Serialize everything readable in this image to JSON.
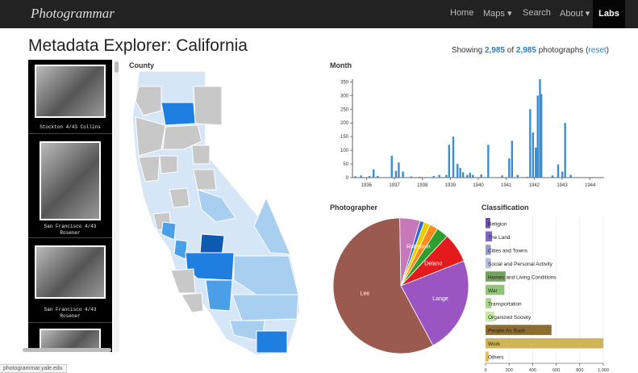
{
  "nav": {
    "brand": "Photogrammar",
    "items": [
      "Home",
      "Maps",
      "Search",
      "About"
    ],
    "labs": "Labs"
  },
  "page": {
    "title": "Metadata Explorer: California",
    "showing_prefix": "Showing",
    "showing_count": "2,985",
    "showing_of": "of",
    "showing_total": "2,985",
    "showing_suffix": "photographs (",
    "reset": "reset",
    "reset_close": ")"
  },
  "photos": [
    {
      "caption_1": "Stockton 4/43 Collins",
      "caption_2": ""
    },
    {
      "caption_1": "San Francisco 4/43",
      "caption_2": "Rosener"
    },
    {
      "caption_1": "San Francisco 4/43",
      "caption_2": "Rosener"
    },
    {
      "caption_1": "",
      "caption_2": ""
    }
  ],
  "sections": {
    "county": "County",
    "month": "Month",
    "photographer": "Photographer",
    "classification": "Classification"
  },
  "status_bar": "photogrammar.yale.edu",
  "colors": {
    "map_light": "#d6e6f7",
    "map_mid": "#a8cff0",
    "map_blue": "#4a9fe6",
    "map_bright": "#1f7fe0",
    "map_dark": "#0d5ab0",
    "map_gray": "#c8c8c8",
    "bar_blue": "#3a8ed0"
  },
  "chart_data": [
    {
      "type": "bar",
      "title": "Month",
      "x_ticks": [
        "1936",
        "1937",
        "1938",
        "1939",
        "1940",
        "1941",
        "1942",
        "1943",
        "1944"
      ],
      "y_ticks": [
        0,
        50,
        100,
        150,
        200,
        250,
        300,
        350
      ],
      "ylim": [
        0,
        360
      ],
      "x_range": [
        1935.5,
        1944.5
      ],
      "bars": [
        {
          "x": 1935.6,
          "y": 5
        },
        {
          "x": 1935.8,
          "y": 8
        },
        {
          "x": 1936.1,
          "y": 6
        },
        {
          "x": 1936.25,
          "y": 30
        },
        {
          "x": 1936.4,
          "y": 6
        },
        {
          "x": 1936.9,
          "y": 80
        },
        {
          "x": 1937.05,
          "y": 25
        },
        {
          "x": 1937.15,
          "y": 55
        },
        {
          "x": 1937.3,
          "y": 22
        },
        {
          "x": 1937.6,
          "y": 4
        },
        {
          "x": 1937.9,
          "y": 3
        },
        {
          "x": 1938.4,
          "y": 6
        },
        {
          "x": 1938.6,
          "y": 10
        },
        {
          "x": 1938.85,
          "y": 10
        },
        {
          "x": 1938.95,
          "y": 120
        },
        {
          "x": 1939.1,
          "y": 150
        },
        {
          "x": 1939.25,
          "y": 50
        },
        {
          "x": 1939.35,
          "y": 35
        },
        {
          "x": 1939.45,
          "y": 20
        },
        {
          "x": 1939.6,
          "y": 10
        },
        {
          "x": 1939.7,
          "y": 18
        },
        {
          "x": 1939.8,
          "y": 10
        },
        {
          "x": 1940.1,
          "y": 12
        },
        {
          "x": 1940.35,
          "y": 120
        },
        {
          "x": 1940.85,
          "y": 8
        },
        {
          "x": 1941.1,
          "y": 70
        },
        {
          "x": 1941.2,
          "y": 135
        },
        {
          "x": 1941.4,
          "y": 10
        },
        {
          "x": 1941.75,
          "y": 3
        },
        {
          "x": 1941.85,
          "y": 250
        },
        {
          "x": 1941.95,
          "y": 165
        },
        {
          "x": 1942.05,
          "y": 110
        },
        {
          "x": 1942.12,
          "y": 300
        },
        {
          "x": 1942.2,
          "y": 360
        },
        {
          "x": 1942.25,
          "y": 305
        },
        {
          "x": 1942.65,
          "y": 8
        },
        {
          "x": 1942.85,
          "y": 48
        },
        {
          "x": 1943.0,
          "y": 22
        },
        {
          "x": 1943.1,
          "y": 200
        },
        {
          "x": 1943.3,
          "y": 10
        }
      ]
    },
    {
      "type": "pie",
      "title": "Photographer",
      "slices": [
        {
          "name": "Lee",
          "value": 1720,
          "color": "#9b5a4f"
        },
        {
          "name": "Lange",
          "value": 690,
          "color": "#9b55c2"
        },
        {
          "name": "Delano",
          "value": 210,
          "color": "#e41a1c"
        },
        {
          "name": "",
          "value": 85,
          "color": "#2ca02c"
        },
        {
          "name": "Rothstein",
          "value": 60,
          "color": "#ff8c1a"
        },
        {
          "name": "",
          "value": 45,
          "color": "#e8d000"
        },
        {
          "name": "",
          "value": 30,
          "color": "#2b6bd8"
        },
        {
          "name": "",
          "value": 145,
          "color": "#c678b8"
        }
      ]
    },
    {
      "type": "bar",
      "title": "Classification",
      "orientation": "horizontal",
      "x_ticks": [
        "0",
        "200",
        "400",
        "600",
        "800",
        "1,000"
      ],
      "xlim": [
        0,
        1000
      ],
      "categories": [
        "Religion",
        "The Land",
        "Cities and Towns",
        "Social and Personal Activity",
        "Homes and Living Conditions",
        "War",
        "Transportation",
        "Organized Society",
        "People As Such",
        "Work",
        "Others"
      ],
      "values": [
        40,
        55,
        45,
        45,
        170,
        160,
        50,
        75,
        560,
        1000,
        25
      ],
      "colors": [
        "#6a51a3",
        "#7b68c9",
        "#9e9ac8",
        "#bcbddc",
        "#74a060",
        "#91c47a",
        "#a8d48e",
        "#c7e9a5",
        "#8c6d31",
        "#cfb45a",
        "#e7ba52"
      ]
    }
  ]
}
